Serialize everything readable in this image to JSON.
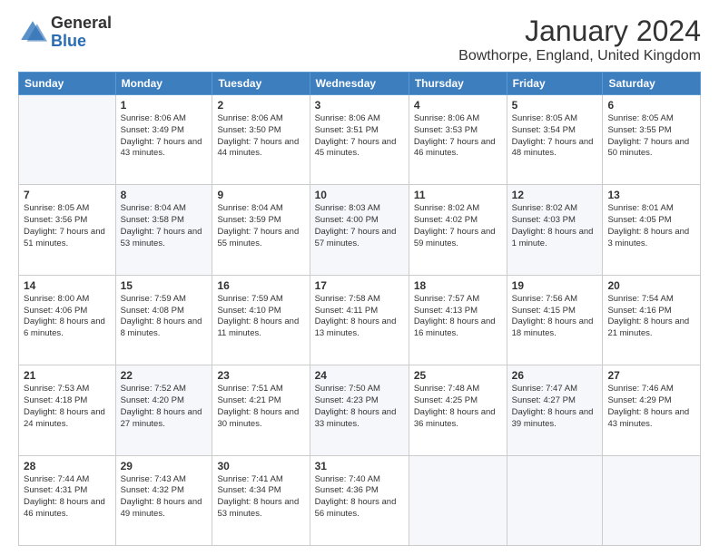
{
  "header": {
    "logo": {
      "general": "General",
      "blue": "Blue"
    },
    "title": "January 2024",
    "location": "Bowthorpe, England, United Kingdom"
  },
  "days_of_week": [
    "Sunday",
    "Monday",
    "Tuesday",
    "Wednesday",
    "Thursday",
    "Friday",
    "Saturday"
  ],
  "weeks": [
    [
      {
        "date": "",
        "sunrise": "",
        "sunset": "",
        "daylight": ""
      },
      {
        "date": "1",
        "sunrise": "Sunrise: 8:06 AM",
        "sunset": "Sunset: 3:49 PM",
        "daylight": "Daylight: 7 hours and 43 minutes."
      },
      {
        "date": "2",
        "sunrise": "Sunrise: 8:06 AM",
        "sunset": "Sunset: 3:50 PM",
        "daylight": "Daylight: 7 hours and 44 minutes."
      },
      {
        "date": "3",
        "sunrise": "Sunrise: 8:06 AM",
        "sunset": "Sunset: 3:51 PM",
        "daylight": "Daylight: 7 hours and 45 minutes."
      },
      {
        "date": "4",
        "sunrise": "Sunrise: 8:06 AM",
        "sunset": "Sunset: 3:53 PM",
        "daylight": "Daylight: 7 hours and 46 minutes."
      },
      {
        "date": "5",
        "sunrise": "Sunrise: 8:05 AM",
        "sunset": "Sunset: 3:54 PM",
        "daylight": "Daylight: 7 hours and 48 minutes."
      },
      {
        "date": "6",
        "sunrise": "Sunrise: 8:05 AM",
        "sunset": "Sunset: 3:55 PM",
        "daylight": "Daylight: 7 hours and 50 minutes."
      }
    ],
    [
      {
        "date": "7",
        "sunrise": "Sunrise: 8:05 AM",
        "sunset": "Sunset: 3:56 PM",
        "daylight": "Daylight: 7 hours and 51 minutes."
      },
      {
        "date": "8",
        "sunrise": "Sunrise: 8:04 AM",
        "sunset": "Sunset: 3:58 PM",
        "daylight": "Daylight: 7 hours and 53 minutes."
      },
      {
        "date": "9",
        "sunrise": "Sunrise: 8:04 AM",
        "sunset": "Sunset: 3:59 PM",
        "daylight": "Daylight: 7 hours and 55 minutes."
      },
      {
        "date": "10",
        "sunrise": "Sunrise: 8:03 AM",
        "sunset": "Sunset: 4:00 PM",
        "daylight": "Daylight: 7 hours and 57 minutes."
      },
      {
        "date": "11",
        "sunrise": "Sunrise: 8:02 AM",
        "sunset": "Sunset: 4:02 PM",
        "daylight": "Daylight: 7 hours and 59 minutes."
      },
      {
        "date": "12",
        "sunrise": "Sunrise: 8:02 AM",
        "sunset": "Sunset: 4:03 PM",
        "daylight": "Daylight: 8 hours and 1 minute."
      },
      {
        "date": "13",
        "sunrise": "Sunrise: 8:01 AM",
        "sunset": "Sunset: 4:05 PM",
        "daylight": "Daylight: 8 hours and 3 minutes."
      }
    ],
    [
      {
        "date": "14",
        "sunrise": "Sunrise: 8:00 AM",
        "sunset": "Sunset: 4:06 PM",
        "daylight": "Daylight: 8 hours and 6 minutes."
      },
      {
        "date": "15",
        "sunrise": "Sunrise: 7:59 AM",
        "sunset": "Sunset: 4:08 PM",
        "daylight": "Daylight: 8 hours and 8 minutes."
      },
      {
        "date": "16",
        "sunrise": "Sunrise: 7:59 AM",
        "sunset": "Sunset: 4:10 PM",
        "daylight": "Daylight: 8 hours and 11 minutes."
      },
      {
        "date": "17",
        "sunrise": "Sunrise: 7:58 AM",
        "sunset": "Sunset: 4:11 PM",
        "daylight": "Daylight: 8 hours and 13 minutes."
      },
      {
        "date": "18",
        "sunrise": "Sunrise: 7:57 AM",
        "sunset": "Sunset: 4:13 PM",
        "daylight": "Daylight: 8 hours and 16 minutes."
      },
      {
        "date": "19",
        "sunrise": "Sunrise: 7:56 AM",
        "sunset": "Sunset: 4:15 PM",
        "daylight": "Daylight: 8 hours and 18 minutes."
      },
      {
        "date": "20",
        "sunrise": "Sunrise: 7:54 AM",
        "sunset": "Sunset: 4:16 PM",
        "daylight": "Daylight: 8 hours and 21 minutes."
      }
    ],
    [
      {
        "date": "21",
        "sunrise": "Sunrise: 7:53 AM",
        "sunset": "Sunset: 4:18 PM",
        "daylight": "Daylight: 8 hours and 24 minutes."
      },
      {
        "date": "22",
        "sunrise": "Sunrise: 7:52 AM",
        "sunset": "Sunset: 4:20 PM",
        "daylight": "Daylight: 8 hours and 27 minutes."
      },
      {
        "date": "23",
        "sunrise": "Sunrise: 7:51 AM",
        "sunset": "Sunset: 4:21 PM",
        "daylight": "Daylight: 8 hours and 30 minutes."
      },
      {
        "date": "24",
        "sunrise": "Sunrise: 7:50 AM",
        "sunset": "Sunset: 4:23 PM",
        "daylight": "Daylight: 8 hours and 33 minutes."
      },
      {
        "date": "25",
        "sunrise": "Sunrise: 7:48 AM",
        "sunset": "Sunset: 4:25 PM",
        "daylight": "Daylight: 8 hours and 36 minutes."
      },
      {
        "date": "26",
        "sunrise": "Sunrise: 7:47 AM",
        "sunset": "Sunset: 4:27 PM",
        "daylight": "Daylight: 8 hours and 39 minutes."
      },
      {
        "date": "27",
        "sunrise": "Sunrise: 7:46 AM",
        "sunset": "Sunset: 4:29 PM",
        "daylight": "Daylight: 8 hours and 43 minutes."
      }
    ],
    [
      {
        "date": "28",
        "sunrise": "Sunrise: 7:44 AM",
        "sunset": "Sunset: 4:31 PM",
        "daylight": "Daylight: 8 hours and 46 minutes."
      },
      {
        "date": "29",
        "sunrise": "Sunrise: 7:43 AM",
        "sunset": "Sunset: 4:32 PM",
        "daylight": "Daylight: 8 hours and 49 minutes."
      },
      {
        "date": "30",
        "sunrise": "Sunrise: 7:41 AM",
        "sunset": "Sunset: 4:34 PM",
        "daylight": "Daylight: 8 hours and 53 minutes."
      },
      {
        "date": "31",
        "sunrise": "Sunrise: 7:40 AM",
        "sunset": "Sunset: 4:36 PM",
        "daylight": "Daylight: 8 hours and 56 minutes."
      },
      {
        "date": "",
        "sunrise": "",
        "sunset": "",
        "daylight": ""
      },
      {
        "date": "",
        "sunrise": "",
        "sunset": "",
        "daylight": ""
      },
      {
        "date": "",
        "sunrise": "",
        "sunset": "",
        "daylight": ""
      }
    ]
  ]
}
